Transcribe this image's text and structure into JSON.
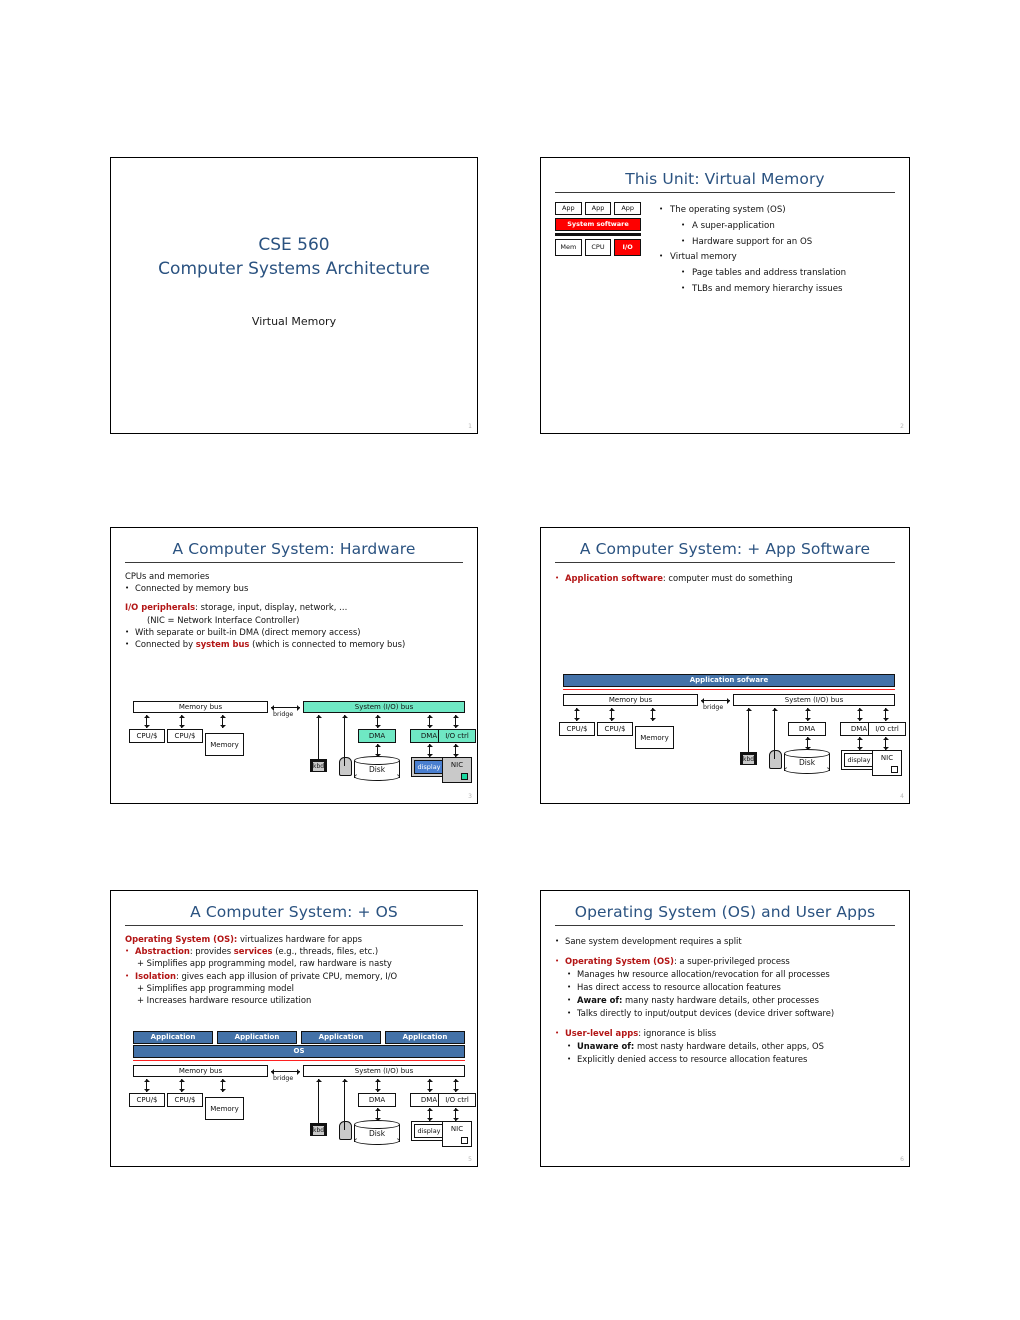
{
  "document": {
    "course": "CSE 560",
    "course_subtitle": "Computer Systems Architecture",
    "deck_subtitle": "Virtual Memory"
  },
  "colors": {
    "title_blue": "#2a5280",
    "accent_red": "#b31515",
    "bright_red": "#fe0000",
    "teal_bus": "#6fe8c4",
    "software_blue": "#4472a8",
    "display_blue": "#4a7fd0",
    "nic_green": "#19d8a0"
  },
  "slides": [
    {
      "number": "1",
      "kind": "cover",
      "title_line1": "CSE 560",
      "title_line2": "Computer Systems Architecture",
      "subtitle": "Virtual Memory"
    },
    {
      "number": "2",
      "kind": "unit-overview",
      "title": "This Unit: Virtual Memory",
      "stack": {
        "apps": [
          "App",
          "App",
          "App"
        ],
        "system_software": "System software",
        "hardware": [
          "Mem",
          "CPU",
          "I/O"
        ]
      },
      "bullets": [
        {
          "level": 1,
          "text": "The operating system (OS)"
        },
        {
          "level": 2,
          "text": "A super-application"
        },
        {
          "level": 2,
          "text": "Hardware support for an OS"
        },
        {
          "level": 1,
          "text": "Virtual memory"
        },
        {
          "level": 2,
          "text": "Page tables and address translation"
        },
        {
          "level": 2,
          "text": "TLBs and memory hierarchy issues"
        }
      ]
    },
    {
      "number": "3",
      "kind": "hardware",
      "title": "A Computer System: Hardware",
      "lines": [
        "CPUs and memories",
        "Connected by memory bus",
        "I/O peripherals",
        ": storage, input, display, network, …",
        "(NIC = Network Interface Controller)",
        "With separate or built-in DMA (direct memory access)",
        "Connected by ",
        "system bus",
        " (which is connected to memory bus)"
      ]
    },
    {
      "number": "4",
      "kind": "app-software",
      "title": "A Computer System: + App Software",
      "bullet_bold": "Application software",
      "bullet_rest": ": computer must do something",
      "layer_label": "Application sofware"
    },
    {
      "number": "5",
      "kind": "os",
      "title": "A Computer System: + OS",
      "lines": {
        "l1_bold": "Operating System (OS):",
        "l1_rest": " virtualizes hardware for apps",
        "l2_bold": "Abstraction",
        "l2_mid": ": provides ",
        "l2_bold2": "services",
        "l2_rest": " (e.g., threads, files, etc.)",
        "l3": "+ Simplifies app programming model, raw hardware is nasty",
        "l4_bold": "Isolation",
        "l4_rest": ": gives each app illusion of private CPU, memory, I/O",
        "l5": "+ Simplifies app programming model",
        "l6": "+ Increases hardware resource utilization"
      },
      "app_labels": [
        "Application",
        "Application",
        "Application",
        "Application"
      ],
      "os_label": "OS"
    },
    {
      "number": "6",
      "kind": "os-user-apps",
      "title": "Operating System (OS) and User Apps",
      "bullets": [
        {
          "level": 1,
          "text": "Sane system development requires a split"
        },
        {
          "level": 1,
          "bold": "Operating System (OS)",
          "text": ": a super-privileged process"
        },
        {
          "level": 2,
          "text": "Manages hw resource allocation/revocation for all processes"
        },
        {
          "level": 2,
          "text": "Has direct access to resource allocation features"
        },
        {
          "level": 2,
          "bold_inline": "Aware of:",
          "text": " many nasty hardware details, other processes"
        },
        {
          "level": 2,
          "text": "Talks directly to input/output devices (device driver software)"
        },
        {
          "level": 1,
          "bold": "User-level apps",
          "text": ": ignorance is bliss"
        },
        {
          "level": 2,
          "bold_inline": "Unaware of:",
          "text": " most nasty hardware details, other apps, OS"
        },
        {
          "level": 2,
          "text": "Explicitly denied access to resource allocation features"
        }
      ]
    }
  ],
  "diagram": {
    "memory_bus": "Memory bus",
    "system_bus": "System (I/O) bus",
    "bridge": "bridge",
    "cpu1": "CPU/$",
    "cpu2": "CPU/$",
    "memory": "Memory",
    "dma1": "DMA",
    "dma2": "DMA",
    "ioctrl": "I/O ctrl",
    "kbd": "kbd",
    "disk": "Disk",
    "display": "display",
    "nic": "NIC"
  }
}
